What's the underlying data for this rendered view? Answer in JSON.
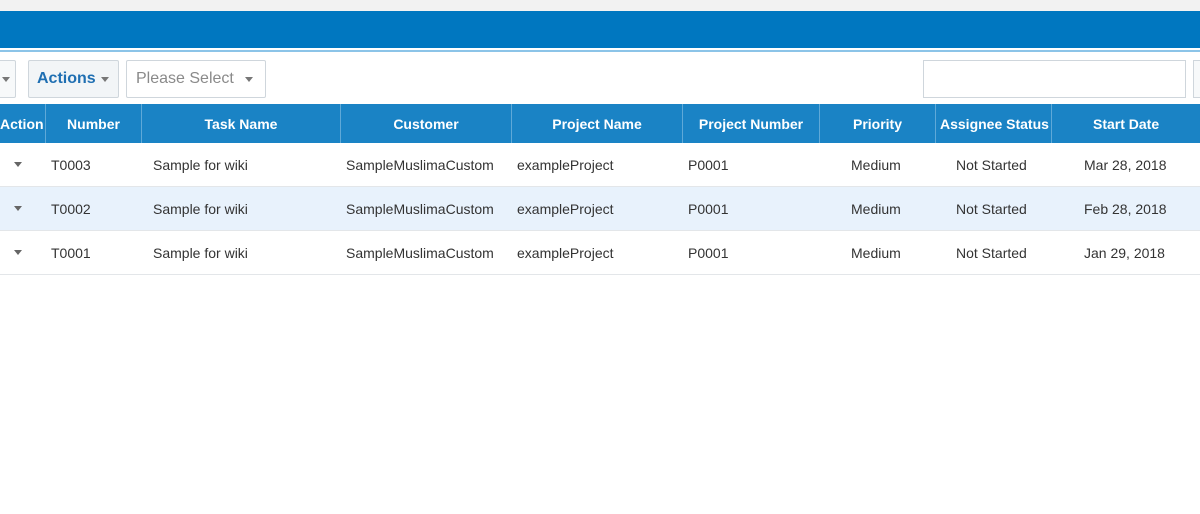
{
  "toolbar": {
    "actions_label": "Actions",
    "select_placeholder": "Please Select",
    "search_value": ""
  },
  "table": {
    "columns": [
      "Action",
      "Number",
      "Task Name",
      "Customer",
      "Project Name",
      "Project Number",
      "Priority",
      "Assignee Status",
      "Start Date"
    ],
    "rows": [
      {
        "number": "T0003",
        "task_name": "Sample for wiki",
        "customer": "SampleMuslimaCustom",
        "project_name": "exampleProject",
        "project_number": "P0001",
        "priority": "Medium",
        "assignee_status": "Not Started",
        "start_date": "Mar 28, 2018"
      },
      {
        "number": "T0002",
        "task_name": "Sample for wiki",
        "customer": "SampleMuslimaCustom",
        "project_name": "exampleProject",
        "project_number": "P0001",
        "priority": "Medium",
        "assignee_status": "Not Started",
        "start_date": "Feb 28, 2018"
      },
      {
        "number": "T0001",
        "task_name": "Sample for wiki",
        "customer": "SampleMuslimaCustom",
        "project_name": "exampleProject",
        "project_number": "P0001",
        "priority": "Medium",
        "assignee_status": "Not Started",
        "start_date": "Jan 29, 2018"
      }
    ]
  },
  "colors": {
    "header_bar": "#0077c0",
    "table_header": "#1a83c5",
    "row_highlight": "#e8f2fc",
    "actions_text": "#1f6fb2"
  },
  "icons": {
    "row_action": "caret-down-icon",
    "dropdown": "caret-down-icon"
  }
}
